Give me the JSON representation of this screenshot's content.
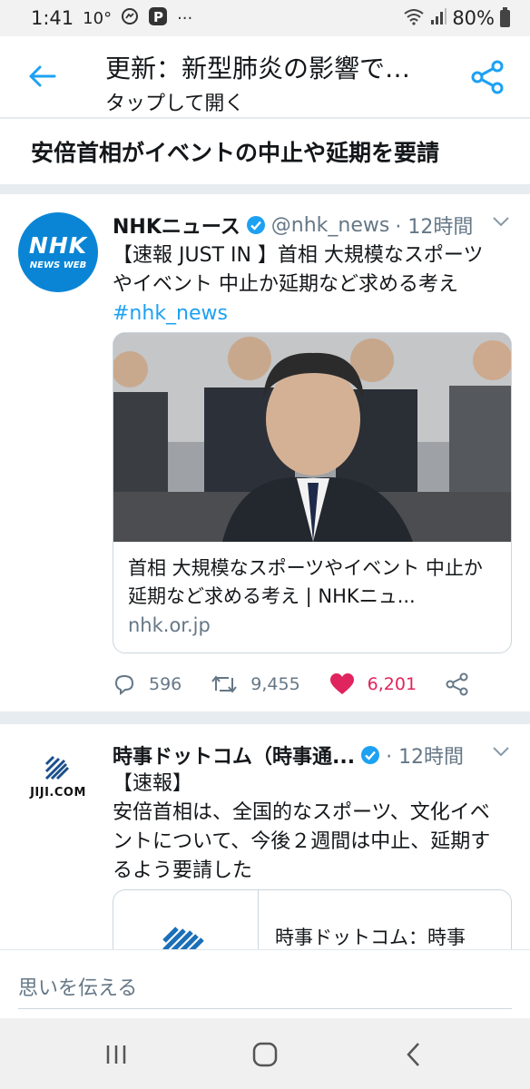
{
  "status_bar": {
    "time": "1:41",
    "temperature": "10°",
    "battery": "80%",
    "icons": [
      "messenger-icon",
      "paypay-icon",
      "more-dots-icon",
      "wifi-icon",
      "signal-icon",
      "battery-icon"
    ]
  },
  "app_bar": {
    "title": "更新：新型肺炎の影響で…",
    "subtitle": "タップして開く",
    "back_icon": "arrow-left-icon",
    "share_icon": "share-icon"
  },
  "headline": "安倍首相がイベントの中止や延期を要請",
  "tweets": [
    {
      "avatar_text": "NHK",
      "avatar_subtext": "NEWS WEB",
      "name": "NHKニュース",
      "handle": "@nhk_news",
      "time": "· 12時間",
      "text": "【速報 JUST IN 】首相 大規模なスポーツやイベント 中止か延期など求める考え",
      "hashtag": "#nhk_news",
      "link_title": "首相 大規模なスポーツやイベント 中止か延期など求める考え | NHKニュ...",
      "link_domain": "nhk.or.jp",
      "replies": "596",
      "retweets": "9,455",
      "likes": "6,201"
    },
    {
      "avatar_text": "JIJI.COM",
      "name": "時事ドットコム（時事通...",
      "time": "· 12時間",
      "text_line1": "【速報】",
      "text_body": " 安倍首相は、全国的なスポーツ、文化イベントについて、今後２週間は中止、延期するよう要請した",
      "link_title": "時事ドットコム：時事"
    }
  ],
  "reply": {
    "placeholder": "思いを伝える"
  },
  "colors": {
    "accent": "#1da1f2",
    "like": "#e0245e",
    "secondary": "#657786"
  }
}
